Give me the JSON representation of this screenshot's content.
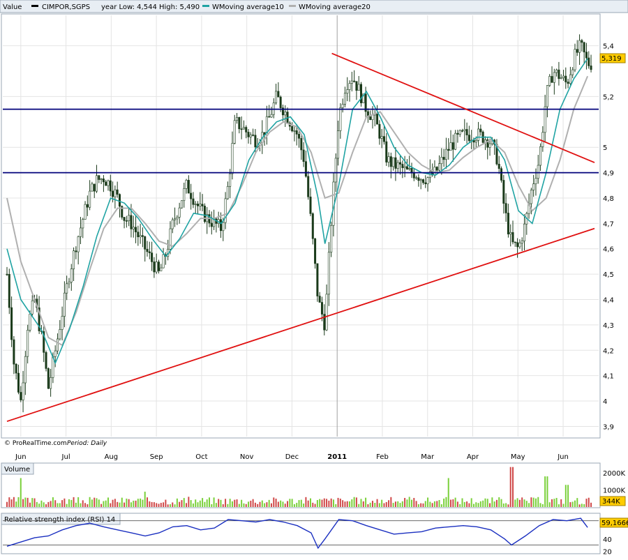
{
  "header": {
    "value_label": "Value",
    "symbol": "CIMPOR,SGPS",
    "year_range": "year Low: 4,544 High: 5,490",
    "ma10_label": "WMoving average10",
    "ma20_label": "WMoving average20"
  },
  "footer": {
    "credit": "© ProRealTime.com",
    "period": "Period: Daily"
  },
  "colors": {
    "candle": "#1a3a1a",
    "ma10": "#1fa3a3",
    "ma20": "#b0b0b0",
    "hline": "#00007a",
    "trend": "#e01010",
    "vol_up": "#7ad03a",
    "vol_down": "#d04848",
    "rsi": "#1a2fc0",
    "last_price_bg": "#ffcc00",
    "last_vol_bg": "#ffcc00"
  },
  "chart_data": [
    {
      "type": "candlestick",
      "title": "CIMPOR,SGPS",
      "ylim": [
        3.86,
        5.52
      ],
      "yticks": [
        "5,4",
        "5,2",
        "5",
        "4,9",
        "4,8",
        "4,7",
        "4,6",
        "4,5",
        "4,4",
        "4,3",
        "4,2",
        "4,1",
        "4",
        "3,9"
      ],
      "ytick_values": [
        5.4,
        5.2,
        5.0,
        4.9,
        4.8,
        4.7,
        4.6,
        4.5,
        4.4,
        4.3,
        4.2,
        4.1,
        4.0,
        3.9
      ],
      "x_months": [
        "Jun",
        "Jul",
        "Aug",
        "Sep",
        "Oct",
        "Nov",
        "Dec",
        "2011",
        "Feb",
        "Mar",
        "Apr",
        "May",
        "Jun"
      ],
      "last_price": "5,319",
      "close_path": [
        [
          0,
          4.5
        ],
        [
          1,
          4.15
        ],
        [
          2,
          4.0
        ],
        [
          3,
          4.3
        ],
        [
          4,
          4.4
        ],
        [
          5,
          4.25
        ],
        [
          6,
          4.05
        ],
        [
          7,
          4.2
        ],
        [
          8,
          4.35
        ],
        [
          9,
          4.5
        ],
        [
          10,
          4.62
        ],
        [
          11,
          4.72
        ],
        [
          12,
          4.82
        ],
        [
          13,
          4.87
        ],
        [
          14,
          4.88
        ],
        [
          15,
          4.85
        ],
        [
          16,
          4.8
        ],
        [
          17,
          4.72
        ],
        [
          18,
          4.7
        ],
        [
          19,
          4.65
        ],
        [
          20,
          4.6
        ],
        [
          21,
          4.55
        ],
        [
          22,
          4.5
        ],
        [
          23,
          4.58
        ],
        [
          24,
          4.7
        ],
        [
          25,
          4.78
        ],
        [
          26,
          4.85
        ],
        [
          27,
          4.8
        ],
        [
          28,
          4.75
        ],
        [
          29,
          4.72
        ],
        [
          30,
          4.7
        ],
        [
          31,
          4.68
        ],
        [
          32,
          4.85
        ],
        [
          33,
          5.1
        ],
        [
          34,
          5.08
        ],
        [
          35,
          5.05
        ],
        [
          36,
          5.03
        ],
        [
          37,
          5.05
        ],
        [
          38,
          5.12
        ],
        [
          39,
          5.2
        ],
        [
          40,
          5.15
        ],
        [
          41,
          5.1
        ],
        [
          42,
          5.05
        ],
        [
          43,
          4.95
        ],
        [
          44,
          4.7
        ],
        [
          45,
          4.4
        ],
        [
          46,
          4.3
        ],
        [
          47,
          4.75
        ],
        [
          48,
          5.12
        ],
        [
          49,
          5.25
        ],
        [
          50,
          5.28
        ],
        [
          51,
          5.22
        ],
        [
          52,
          5.15
        ],
        [
          53,
          5.12
        ],
        [
          54,
          5.05
        ],
        [
          55,
          4.95
        ],
        [
          56,
          4.93
        ],
        [
          57,
          4.92
        ],
        [
          58,
          4.9
        ],
        [
          59,
          4.9
        ],
        [
          60,
          4.88
        ],
        [
          61,
          4.88
        ],
        [
          62,
          4.9
        ],
        [
          63,
          4.95
        ],
        [
          64,
          5.0
        ],
        [
          65,
          5.03
        ],
        [
          66,
          5.05
        ],
        [
          67,
          5.05
        ],
        [
          68,
          5.05
        ],
        [
          69,
          5.04
        ],
        [
          70,
          5.02
        ],
        [
          71,
          4.95
        ],
        [
          72,
          4.75
        ],
        [
          73,
          4.62
        ],
        [
          74,
          4.6
        ],
        [
          75,
          4.7
        ],
        [
          76,
          4.85
        ],
        [
          77,
          4.95
        ],
        [
          78,
          5.2
        ],
        [
          79,
          5.3
        ],
        [
          80,
          5.28
        ],
        [
          81,
          5.25
        ],
        [
          82,
          5.35
        ],
        [
          83,
          5.4
        ],
        [
          84,
          5.33
        ]
      ],
      "ma10_path": [
        [
          0,
          4.6
        ],
        [
          2,
          4.4
        ],
        [
          5,
          4.28
        ],
        [
          7,
          4.15
        ],
        [
          9,
          4.28
        ],
        [
          11,
          4.45
        ],
        [
          13,
          4.65
        ],
        [
          15,
          4.8
        ],
        [
          17,
          4.78
        ],
        [
          19,
          4.72
        ],
        [
          21,
          4.64
        ],
        [
          23,
          4.57
        ],
        [
          25,
          4.64
        ],
        [
          27,
          4.74
        ],
        [
          29,
          4.73
        ],
        [
          31,
          4.7
        ],
        [
          33,
          4.78
        ],
        [
          35,
          4.95
        ],
        [
          37,
          5.04
        ],
        [
          39,
          5.1
        ],
        [
          41,
          5.12
        ],
        [
          43,
          5.05
        ],
        [
          45,
          4.8
        ],
        [
          46,
          4.62
        ],
        [
          48,
          4.85
        ],
        [
          50,
          5.15
        ],
        [
          52,
          5.22
        ],
        [
          54,
          5.12
        ],
        [
          56,
          5.0
        ],
        [
          58,
          4.93
        ],
        [
          60,
          4.9
        ],
        [
          62,
          4.89
        ],
        [
          64,
          4.93
        ],
        [
          66,
          5.0
        ],
        [
          68,
          5.04
        ],
        [
          70,
          5.04
        ],
        [
          72,
          4.95
        ],
        [
          74,
          4.75
        ],
        [
          76,
          4.7
        ],
        [
          78,
          4.9
        ],
        [
          80,
          5.15
        ],
        [
          82,
          5.27
        ],
        [
          84,
          5.35
        ]
      ],
      "ma20_path": [
        [
          0,
          4.8
        ],
        [
          2,
          4.55
        ],
        [
          4,
          4.4
        ],
        [
          6,
          4.25
        ],
        [
          8,
          4.22
        ],
        [
          10,
          4.35
        ],
        [
          12,
          4.52
        ],
        [
          14,
          4.68
        ],
        [
          16,
          4.76
        ],
        [
          18,
          4.76
        ],
        [
          20,
          4.7
        ],
        [
          22,
          4.63
        ],
        [
          24,
          4.61
        ],
        [
          26,
          4.66
        ],
        [
          28,
          4.72
        ],
        [
          30,
          4.72
        ],
        [
          32,
          4.74
        ],
        [
          34,
          4.85
        ],
        [
          36,
          4.98
        ],
        [
          38,
          5.06
        ],
        [
          40,
          5.1
        ],
        [
          42,
          5.08
        ],
        [
          44,
          4.98
        ],
        [
          46,
          4.8
        ],
        [
          48,
          4.82
        ],
        [
          50,
          4.98
        ],
        [
          52,
          5.12
        ],
        [
          54,
          5.14
        ],
        [
          56,
          5.06
        ],
        [
          58,
          4.98
        ],
        [
          60,
          4.93
        ],
        [
          62,
          4.9
        ],
        [
          64,
          4.91
        ],
        [
          66,
          4.96
        ],
        [
          68,
          5.0
        ],
        [
          70,
          5.03
        ],
        [
          72,
          4.98
        ],
        [
          74,
          4.85
        ],
        [
          76,
          4.75
        ],
        [
          78,
          4.8
        ],
        [
          80,
          4.95
        ],
        [
          82,
          5.15
        ],
        [
          84,
          5.28
        ]
      ],
      "horizontal_lines": [
        5.15,
        4.9
      ],
      "trendlines": [
        {
          "from": [
            0,
            3.92
          ],
          "to": [
            85,
            4.68
          ]
        },
        {
          "from": [
            47,
            5.37
          ],
          "to": [
            85,
            4.94
          ]
        }
      ]
    },
    {
      "type": "bar",
      "title": "Volume",
      "yticks": [
        "2000K",
        "1000K"
      ],
      "ytick_values": [
        2000,
        1000
      ],
      "ylim": [
        0,
        2500
      ],
      "last_value": "344K",
      "spikes": [
        {
          "x": 2,
          "v": 1700,
          "up": true
        },
        {
          "x": 20,
          "v": 900,
          "up": true
        },
        {
          "x": 64,
          "v": 1700,
          "up": true
        },
        {
          "x": 73,
          "v": 2350,
          "up": false
        },
        {
          "x": 78,
          "v": 1800,
          "up": true
        },
        {
          "x": 81,
          "v": 1300,
          "up": true
        }
      ]
    },
    {
      "type": "line",
      "title": "Relative strength index (RSI) 14",
      "yticks": [
        "60",
        "40",
        "20"
      ],
      "ytick_values": [
        60,
        40,
        20
      ],
      "ylim": [
        18,
        80
      ],
      "last_value": "59,1666",
      "values": [
        [
          0,
          28
        ],
        [
          2,
          35
        ],
        [
          4,
          42
        ],
        [
          6,
          45
        ],
        [
          8,
          55
        ],
        [
          10,
          62
        ],
        [
          12,
          66
        ],
        [
          14,
          60
        ],
        [
          16,
          55
        ],
        [
          18,
          50
        ],
        [
          20,
          45
        ],
        [
          22,
          50
        ],
        [
          24,
          60
        ],
        [
          26,
          62
        ],
        [
          28,
          55
        ],
        [
          30,
          58
        ],
        [
          32,
          72
        ],
        [
          34,
          70
        ],
        [
          36,
          68
        ],
        [
          38,
          72
        ],
        [
          40,
          68
        ],
        [
          42,
          62
        ],
        [
          44,
          50
        ],
        [
          45,
          25
        ],
        [
          46,
          40
        ],
        [
          48,
          72
        ],
        [
          50,
          70
        ],
        [
          52,
          62
        ],
        [
          54,
          55
        ],
        [
          56,
          48
        ],
        [
          58,
          50
        ],
        [
          60,
          52
        ],
        [
          62,
          58
        ],
        [
          64,
          60
        ],
        [
          66,
          62
        ],
        [
          68,
          60
        ],
        [
          70,
          55
        ],
        [
          72,
          40
        ],
        [
          73,
          30
        ],
        [
          75,
          45
        ],
        [
          77,
          62
        ],
        [
          79,
          72
        ],
        [
          81,
          70
        ],
        [
          83,
          74
        ],
        [
          84,
          59
        ]
      ]
    }
  ]
}
